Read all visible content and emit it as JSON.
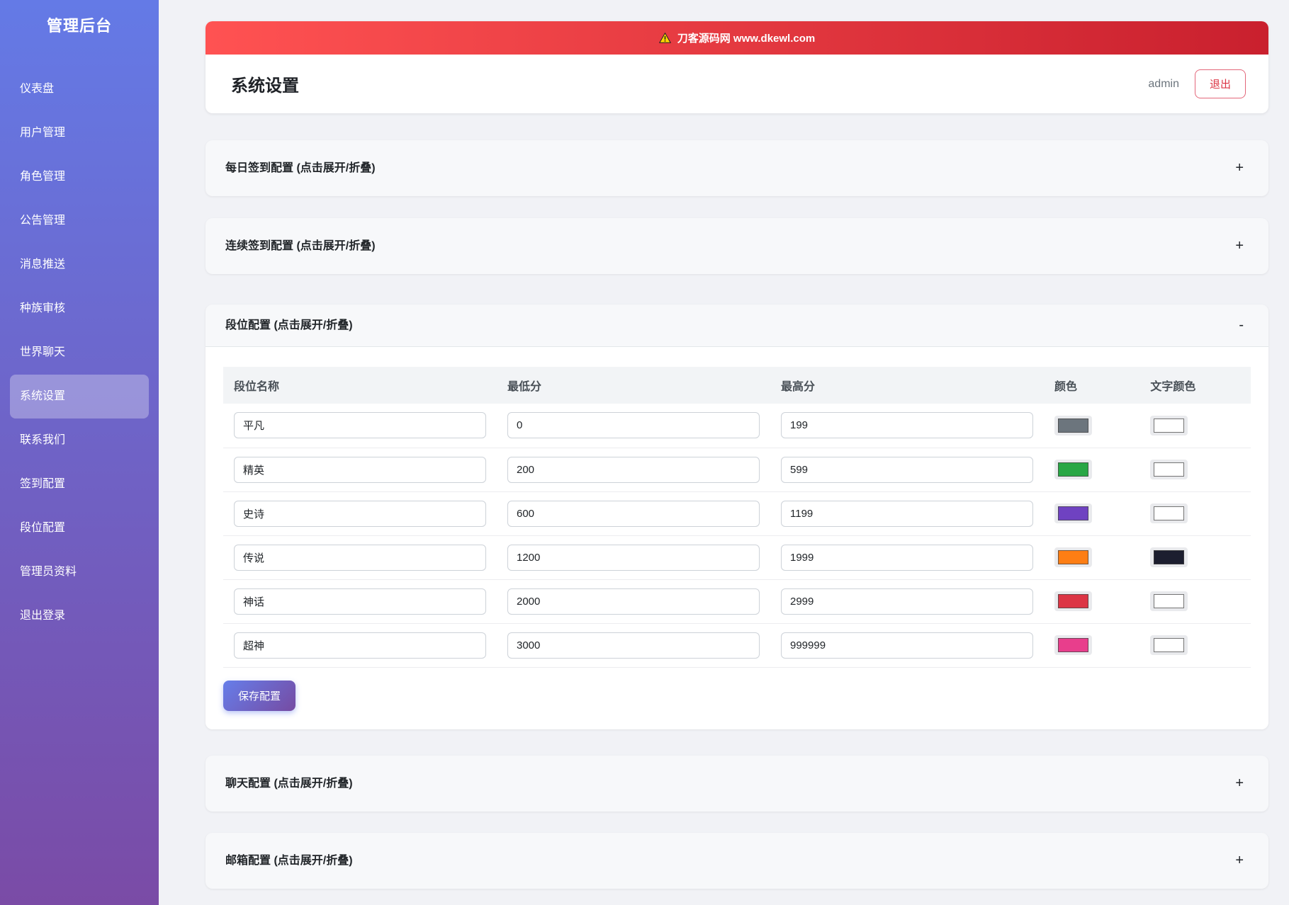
{
  "app": {
    "title": "管理后台"
  },
  "sidebar": {
    "items": [
      {
        "label": "仪表盘",
        "active": false
      },
      {
        "label": "用户管理",
        "active": false
      },
      {
        "label": "角色管理",
        "active": false
      },
      {
        "label": "公告管理",
        "active": false
      },
      {
        "label": "消息推送",
        "active": false
      },
      {
        "label": "种族审核",
        "active": false
      },
      {
        "label": "世界聊天",
        "active": false
      },
      {
        "label": "系统设置",
        "active": true
      },
      {
        "label": "联系我们",
        "active": false
      },
      {
        "label": "签到配置",
        "active": false
      },
      {
        "label": "段位配置",
        "active": false
      },
      {
        "label": "管理员资料",
        "active": false
      },
      {
        "label": "退出登录",
        "active": false
      }
    ]
  },
  "banner": {
    "text": "刀客源码网 www.dkewl.com",
    "icon": "warning-icon"
  },
  "header": {
    "title": "系统设置",
    "user": "admin",
    "logout_label": "退出"
  },
  "sections": [
    {
      "title": "每日签到配置 (点击展开/折叠)",
      "toggle": "+",
      "expanded": false
    },
    {
      "title": "连续签到配置 (点击展开/折叠)",
      "toggle": "+",
      "expanded": false
    },
    {
      "title": "段位配置 (点击展开/折叠)",
      "toggle": "-",
      "expanded": true
    },
    {
      "title": "聊天配置 (点击展开/折叠)",
      "toggle": "+",
      "expanded": false
    },
    {
      "title": "邮箱配置 (点击展开/折叠)",
      "toggle": "+",
      "expanded": false
    }
  ],
  "rank_config": {
    "headers": [
      "段位名称",
      "最低分",
      "最高分",
      "颜色",
      "文字颜色"
    ],
    "rows": [
      {
        "name": "平凡",
        "min": "0",
        "max": "199",
        "color": "#6c757d",
        "text_color": "#ffffff"
      },
      {
        "name": "精英",
        "min": "200",
        "max": "599",
        "color": "#28a745",
        "text_color": "#ffffff"
      },
      {
        "name": "史诗",
        "min": "600",
        "max": "1199",
        "color": "#6f42c1",
        "text_color": "#ffffff"
      },
      {
        "name": "传说",
        "min": "1200",
        "max": "1999",
        "color": "#fd7e14",
        "text_color": "#1c1e2f"
      },
      {
        "name": "神话",
        "min": "2000",
        "max": "2999",
        "color": "#dc3545",
        "text_color": "#ffffff"
      },
      {
        "name": "超神",
        "min": "3000",
        "max": "999999",
        "color": "#e83e8c",
        "text_color": "#ffffff"
      }
    ],
    "save_label": "保存配置"
  },
  "colors": {
    "sidebar_gradient_top": "#647ae6",
    "sidebar_gradient_bottom": "#7a4ba6",
    "banner_gradient_left": "#ff5252",
    "banner_gradient_right": "#c9202e",
    "accent_button_gradient_left": "#667eea",
    "accent_button_gradient_right": "#764ba2",
    "logout_red": "#dc3545",
    "page_background": "#f1f2f6"
  }
}
